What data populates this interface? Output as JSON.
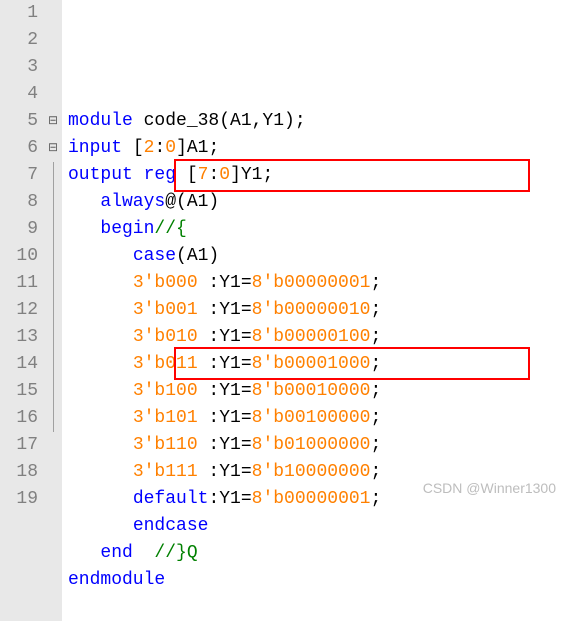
{
  "lines": [
    {
      "n": "1",
      "fold": "",
      "seg": [
        {
          "c": "kw",
          "t": "module"
        },
        {
          "c": "ident",
          "t": " code_38(A1,Y1);"
        }
      ]
    },
    {
      "n": "2",
      "fold": "",
      "seg": [
        {
          "c": "kw",
          "t": "input"
        },
        {
          "c": "ident",
          "t": " ["
        },
        {
          "c": "num",
          "t": "2"
        },
        {
          "c": "ident",
          "t": ":"
        },
        {
          "c": "num",
          "t": "0"
        },
        {
          "c": "ident",
          "t": "]A1;"
        }
      ]
    },
    {
      "n": "3",
      "fold": "",
      "seg": [
        {
          "c": "kw",
          "t": "output"
        },
        {
          "c": "ident",
          "t": " "
        },
        {
          "c": "kw",
          "t": "reg"
        },
        {
          "c": "ident",
          "t": " ["
        },
        {
          "c": "num",
          "t": "7"
        },
        {
          "c": "ident",
          "t": ":"
        },
        {
          "c": "num",
          "t": "0"
        },
        {
          "c": "ident",
          "t": "]Y1;"
        }
      ]
    },
    {
      "n": "4",
      "fold": "",
      "seg": [
        {
          "c": "ident",
          "t": "   "
        },
        {
          "c": "kw",
          "t": "always"
        },
        {
          "c": "ident",
          "t": "@(A1)"
        }
      ]
    },
    {
      "n": "5",
      "fold": "⊟",
      "seg": [
        {
          "c": "ident",
          "t": "   "
        },
        {
          "c": "kw",
          "t": "begin"
        },
        {
          "c": "comment",
          "t": "//{"
        }
      ]
    },
    {
      "n": "6",
      "fold": "⊟",
      "seg": [
        {
          "c": "ident",
          "t": "      "
        },
        {
          "c": "kw",
          "t": "case"
        },
        {
          "c": "ident",
          "t": "(A1)"
        }
      ]
    },
    {
      "n": "7",
      "fold": "|",
      "seg": [
        {
          "c": "ident",
          "t": "      "
        },
        {
          "c": "num",
          "t": "3'b000"
        },
        {
          "c": "ident",
          "t": " :Y1="
        },
        {
          "c": "num",
          "t": "8'b00000001"
        },
        {
          "c": "ident",
          "t": ";"
        }
      ]
    },
    {
      "n": "8",
      "fold": "|",
      "seg": [
        {
          "c": "ident",
          "t": "      "
        },
        {
          "c": "num",
          "t": "3'b001"
        },
        {
          "c": "ident",
          "t": " :Y1="
        },
        {
          "c": "num",
          "t": "8'b00000010"
        },
        {
          "c": "ident",
          "t": ";"
        }
      ]
    },
    {
      "n": "9",
      "fold": "|",
      "seg": [
        {
          "c": "ident",
          "t": "      "
        },
        {
          "c": "num",
          "t": "3'b010"
        },
        {
          "c": "ident",
          "t": " :Y1="
        },
        {
          "c": "num",
          "t": "8'b00000100"
        },
        {
          "c": "ident",
          "t": ";"
        }
      ]
    },
    {
      "n": "10",
      "fold": "|",
      "seg": [
        {
          "c": "ident",
          "t": "      "
        },
        {
          "c": "num",
          "t": "3'b011"
        },
        {
          "c": "ident",
          "t": " :Y1="
        },
        {
          "c": "num",
          "t": "8'b00001000"
        },
        {
          "c": "ident",
          "t": ";"
        }
      ]
    },
    {
      "n": "11",
      "fold": "|",
      "seg": [
        {
          "c": "ident",
          "t": "      "
        },
        {
          "c": "num",
          "t": "3'b100"
        },
        {
          "c": "ident",
          "t": " :Y1="
        },
        {
          "c": "num",
          "t": "8'b00010000"
        },
        {
          "c": "ident",
          "t": ";"
        }
      ]
    },
    {
      "n": "12",
      "fold": "|",
      "seg": [
        {
          "c": "ident",
          "t": "      "
        },
        {
          "c": "num",
          "t": "3'b101"
        },
        {
          "c": "ident",
          "t": " :Y1="
        },
        {
          "c": "num",
          "t": "8'b00100000"
        },
        {
          "c": "ident",
          "t": ";"
        }
      ]
    },
    {
      "n": "13",
      "fold": "|",
      "seg": [
        {
          "c": "ident",
          "t": "      "
        },
        {
          "c": "num",
          "t": "3'b110"
        },
        {
          "c": "ident",
          "t": " :Y1="
        },
        {
          "c": "num",
          "t": "8'b01000000"
        },
        {
          "c": "ident",
          "t": ";"
        }
      ]
    },
    {
      "n": "14",
      "fold": "|",
      "seg": [
        {
          "c": "ident",
          "t": "      "
        },
        {
          "c": "num",
          "t": "3'b111"
        },
        {
          "c": "ident",
          "t": " :Y1="
        },
        {
          "c": "num",
          "t": "8'b10000000"
        },
        {
          "c": "ident",
          "t": ";"
        }
      ]
    },
    {
      "n": "15",
      "fold": "|",
      "seg": [
        {
          "c": "ident",
          "t": "      "
        },
        {
          "c": "kw",
          "t": "default"
        },
        {
          "c": "ident",
          "t": ":Y1="
        },
        {
          "c": "num",
          "t": "8'b00000001"
        },
        {
          "c": "ident",
          "t": ";"
        }
      ]
    },
    {
      "n": "16",
      "fold": "|",
      "seg": [
        {
          "c": "ident",
          "t": "      "
        },
        {
          "c": "kw",
          "t": "endcase"
        }
      ]
    },
    {
      "n": "17",
      "fold": "",
      "seg": [
        {
          "c": "ident",
          "t": "   "
        },
        {
          "c": "kw",
          "t": "end"
        },
        {
          "c": "ident",
          "t": "  "
        },
        {
          "c": "comment",
          "t": "//}Q"
        }
      ]
    },
    {
      "n": "18",
      "fold": "",
      "seg": [
        {
          "c": "kw",
          "t": "endmodule"
        }
      ]
    },
    {
      "n": "19",
      "fold": "",
      "seg": [
        {
          "c": "ident",
          "t": ""
        }
      ]
    }
  ],
  "watermark": "CSDN @Winner1300"
}
